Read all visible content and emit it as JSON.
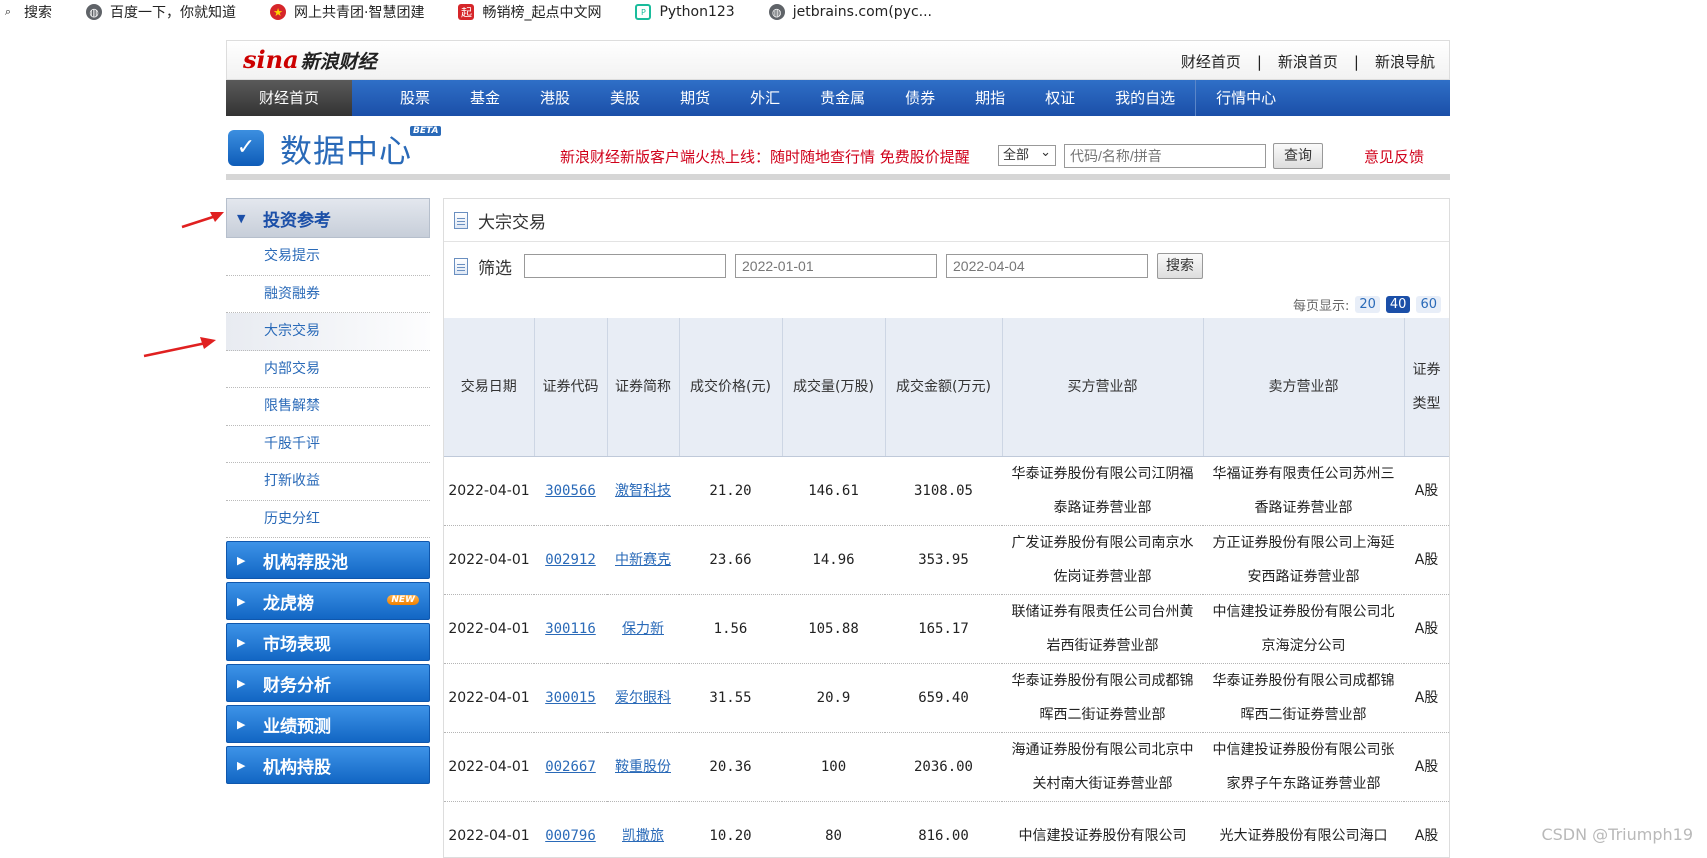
{
  "bookmarks": [
    {
      "label": "搜索",
      "icon": "search-icon"
    },
    {
      "label": "百度一下，你就知道",
      "icon": "globe-icon"
    },
    {
      "label": "网上共青团·智慧团建",
      "icon": "league-emblem-icon"
    },
    {
      "label": "畅销榜_起点中文网",
      "icon": "qidian-icon"
    },
    {
      "label": "Python123",
      "icon": "python123-icon"
    },
    {
      "label": "jetbrains.com(pyc...",
      "icon": "globe-icon"
    }
  ],
  "header": {
    "logo_sina": "sina",
    "logo_text": "新浪财经",
    "top_links": [
      "财经首页",
      "新浪首页",
      "新浪导航"
    ],
    "top_sep": "|"
  },
  "nav": {
    "home": "财经首页",
    "items": [
      "股票",
      "基金",
      "港股",
      "美股",
      "期货",
      "外汇",
      "贵金属",
      "债券",
      "期指",
      "权证",
      "我的自选",
      "行情中心"
    ]
  },
  "datacenter": {
    "title": "数据中心",
    "beta": "BETA",
    "promo": "新浪财经新版客户端火热上线：随时随地查行情  免费股价提醒",
    "scope_select": "全部",
    "search_placeholder": "代码/名称/拼音",
    "query_button": "查询",
    "feedback": "意见反馈"
  },
  "sidebar": {
    "open_section": "投资参考",
    "sub_items": [
      "交易提示",
      "融资融券",
      "大宗交易",
      "内部交易",
      "限售解禁",
      "千股千评",
      "打新收益",
      "历史分红"
    ],
    "active_sub": "大宗交易",
    "sections": [
      {
        "label": "机构荐股池",
        "badge": ""
      },
      {
        "label": "龙虎榜",
        "badge": "NEW"
      },
      {
        "label": "市场表现",
        "badge": ""
      },
      {
        "label": "财务分析",
        "badge": ""
      },
      {
        "label": "业绩预测",
        "badge": ""
      },
      {
        "label": "机构持股",
        "badge": ""
      }
    ]
  },
  "main": {
    "title": "大宗交易",
    "filter_label": "筛选",
    "filter_text": "",
    "start_date": "2022-01-01",
    "end_date": "2022-04-04",
    "search_button": "搜索",
    "per_page_label": "每页显示:",
    "per_page_options": [
      "20",
      "40",
      "60"
    ],
    "per_page_selected": "40",
    "columns": [
      "交易日期",
      "证券代码",
      "证券简称",
      "成交价格(元)",
      "成交量(万股)",
      "成交金额(万元)",
      "买方营业部",
      "卖方营业部",
      "证券类型"
    ],
    "rows": [
      [
        "2022-04-01",
        "300566",
        "激智科技",
        "21.20",
        "146.61",
        "3108.05",
        "华泰证券股份有限公司江阴福泰路证券营业部",
        "华福证券有限责任公司苏州三香路证券营业部",
        "A股"
      ],
      [
        "2022-04-01",
        "002912",
        "中新赛克",
        "23.66",
        "14.96",
        "353.95",
        "广发证券股份有限公司南京水佐岗证券营业部",
        "方正证券股份有限公司上海延安西路证券营业部",
        "A股"
      ],
      [
        "2022-04-01",
        "300116",
        "保力新",
        "1.56",
        "105.88",
        "165.17",
        "联储证券有限责任公司台州黄岩西街证券营业部",
        "中信建投证券股份有限公司北京海淀分公司",
        "A股"
      ],
      [
        "2022-04-01",
        "300015",
        "爱尔眼科",
        "31.55",
        "20.9",
        "659.40",
        "华泰证券股份有限公司成都锦晖西二街证券营业部",
        "华泰证券股份有限公司成都锦晖西二街证券营业部",
        "A股"
      ],
      [
        "2022-04-01",
        "002667",
        "鞍重股份",
        "20.36",
        "100",
        "2036.00",
        "海通证券股份有限公司北京中关村南大街证券营业部",
        "中信建投证券股份有限公司张家界子午东路证券营业部",
        "A股"
      ],
      [
        "2022-04-01",
        "000796",
        "凯撒旅",
        "10.20",
        "80",
        "816.00",
        "中信建投证券股份有限公司",
        "光大证券股份有限公司海口",
        "A股"
      ]
    ]
  },
  "watermark": "CSDN @Triumph19",
  "colors": {
    "nav_blue": "#1b4fa8",
    "promo_red": "#d0021b",
    "link_blue": "#2a6ab8",
    "arrow_red": "#e02020"
  }
}
